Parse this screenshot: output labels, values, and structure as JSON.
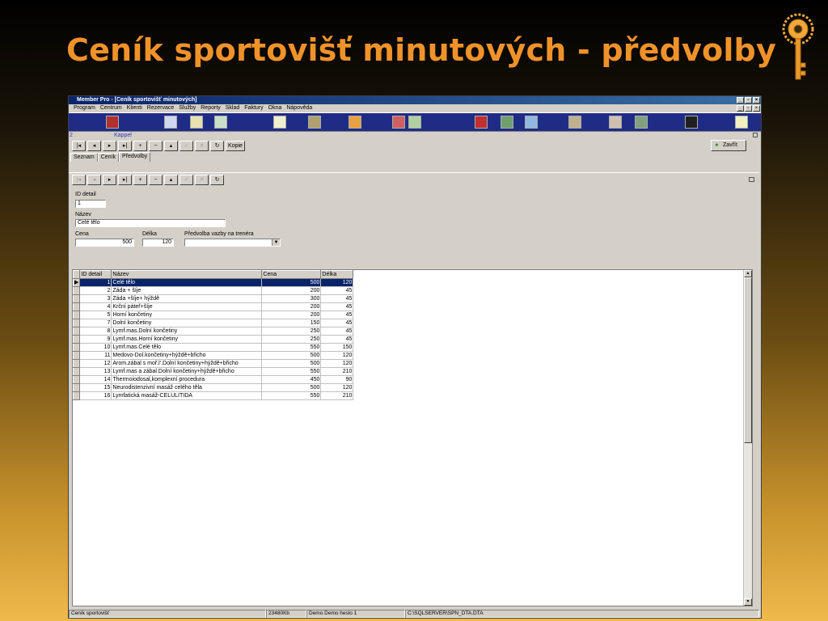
{
  "slide": {
    "title": "Ceník sportovišť minutových - předvolby"
  },
  "window": {
    "title": "Member Pro - [Ceník sportovišť minutových]",
    "menu": [
      "Program",
      "Centrum",
      "Klienti",
      "Rezervace",
      "Služby",
      "Reporty",
      "Sklad",
      "Faktury",
      "Okna",
      "Nápověda"
    ]
  },
  "record": {
    "number": "2",
    "name": "Kappel"
  },
  "toolbar": {
    "kopie": "Kopie",
    "zavrit": "Zavřít"
  },
  "tabs": [
    "Seznam",
    "Ceník",
    "Předvolby"
  ],
  "form": {
    "id_label": "ID detail",
    "id_value": "1",
    "nazev_label": "Název",
    "nazev_value": "Celé tělo",
    "cena_label": "Cena",
    "cena_value": "500",
    "delka_label": "Délka",
    "delka_value": "120",
    "predvolba_label": "Předvolba vazby na trenéra",
    "predvolba_value": ""
  },
  "grid": {
    "headers": [
      "ID detail",
      "Název",
      "Cena",
      "Délka"
    ],
    "rows": [
      [
        "1",
        "Celé tělo",
        "500",
        "120"
      ],
      [
        "2",
        "Záda + šíje",
        "200",
        "45"
      ],
      [
        "3",
        "Záda +šíje+ hýždě",
        "300",
        "45"
      ],
      [
        "4",
        "Krční páteř+šíje",
        "200",
        "45"
      ],
      [
        "5",
        "Horní končetiny",
        "200",
        "45"
      ],
      [
        "7",
        "Dolní končetiny",
        "150",
        "45"
      ],
      [
        "8",
        "Lymf.mas.Dolní končetiny",
        "250",
        "45"
      ],
      [
        "9",
        "Lymf.mas.Horní končetiny",
        "250",
        "45"
      ],
      [
        "10",
        "Lymf.mas.Celé tělo",
        "550",
        "150"
      ],
      [
        "11",
        "Medovo-Dol.končetiny+hýždě+břicho",
        "500",
        "120"
      ],
      [
        "12",
        "Arom.zábal s moř.l'.Dolní končetiny+hýždě+břicho",
        "500",
        "120"
      ],
      [
        "13",
        "Lymf.mas a zábal.Dolní končetiny+hýždě+břicho",
        "550",
        "210"
      ],
      [
        "14",
        "Thermoiodosal,komplexní procedura",
        "450",
        "90"
      ],
      [
        "15",
        "Neurodistenzivní masáž celého těla",
        "500",
        "120"
      ],
      [
        "16",
        "Lymfatická masáž-CELULITIDA",
        "550",
        "210"
      ]
    ]
  },
  "status": [
    "Ceník sportovišť",
    "23480Kb",
    "Demo Demo heslo 1",
    "C:\\SQLSERVER\\SPN_DTA.DTA"
  ],
  "colors": {
    "title": "#f0922a",
    "toolbar_bg": "#1f2c86",
    "selection": "#0a246a"
  }
}
